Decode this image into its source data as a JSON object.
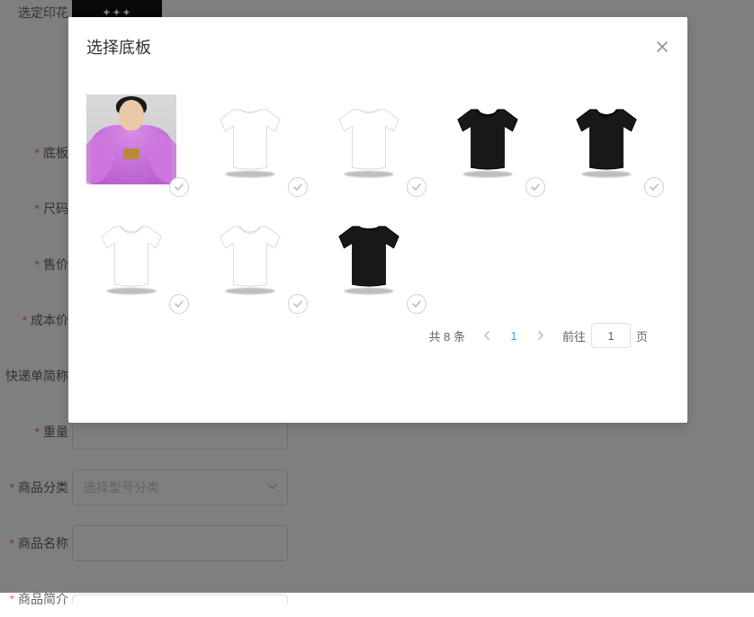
{
  "form": {
    "print_label": "选定印花",
    "base_label": "底板",
    "size_label": "尺码",
    "price_label": "售价",
    "cost_label": "成本价",
    "express_label": "快递单简称",
    "weight_label": "重量",
    "category_label": "商品分类",
    "category_placeholder": "选择型号分类",
    "name_label": "商品名称",
    "intro_label": "商品简介"
  },
  "dialog": {
    "title": "选择底板"
  },
  "tiles": [
    {
      "kind": "photo"
    },
    {
      "kind": "tshirt",
      "fill": "#ffffff",
      "stroke": "#d9d9d9",
      "neck": "crew"
    },
    {
      "kind": "tshirt",
      "fill": "#ffffff",
      "stroke": "#d9d9d9",
      "neck": "crew"
    },
    {
      "kind": "tshirt",
      "fill": "#181818",
      "stroke": "#000000",
      "neck": "scoop"
    },
    {
      "kind": "tshirt",
      "fill": "#181818",
      "stroke": "#000000",
      "neck": "scoop"
    },
    {
      "kind": "tshirt",
      "fill": "#ffffff",
      "stroke": "#d9d9d9",
      "neck": "scoop"
    },
    {
      "kind": "tshirt",
      "fill": "#ffffff",
      "stroke": "#d9d9d9",
      "neck": "scoop"
    },
    {
      "kind": "tshirt",
      "fill": "#181818",
      "stroke": "#000000",
      "neck": "crew"
    }
  ],
  "pagination": {
    "total_text": "共 8 条",
    "current_page": "1",
    "goto_prefix": "前往",
    "goto_value": "1",
    "goto_suffix": "页"
  }
}
